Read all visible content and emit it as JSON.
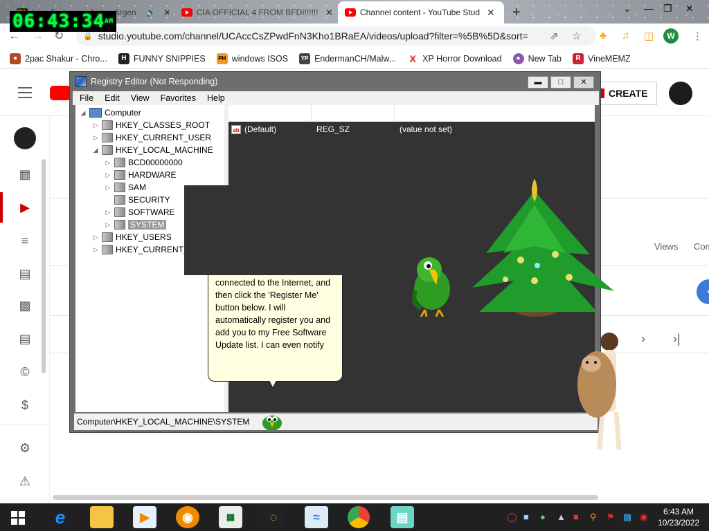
{
  "browser": {
    "tabs": [
      {
        "title": "I am Transrox - Active Argen",
        "icon": "ph-icon"
      },
      {
        "title": "CIA OFFICIAL 4 FROM BFDI!!!!!!",
        "icon": "youtube-icon"
      },
      {
        "title": "Channel content - YouTube Stud",
        "icon": "youtube-icon"
      }
    ],
    "url": "studio.youtube.com/channel/UCAccCsZPwdFnN3Kho1BRaEA/videos/upload?filter=%5B%5D&sort=%...",
    "profile_initial": "W"
  },
  "clock_overlay": {
    "time": "06:43:34",
    "suffix": "AM"
  },
  "bookmarks": [
    {
      "label": "2pac Shakur - Chro...",
      "icon": "car-icon",
      "color": "#b04b2a"
    },
    {
      "label": "FUNNY SNIPPIES",
      "icon": "h-icon",
      "color": "#222222"
    },
    {
      "label": "windows ISOS",
      "icon": "ph-icon",
      "color": "#f7971d"
    },
    {
      "label": "EndermanCH/Malw...",
      "icon": "yp-icon",
      "color": "#444444"
    },
    {
      "label": "XP Horror Download",
      "icon": "x-icon",
      "color": "#e02020"
    },
    {
      "label": "New Tab",
      "icon": "globe-icon",
      "color": "#8a5aa8"
    },
    {
      "label": "VineMEMZ",
      "icon": "r-icon",
      "color": "#cc2233"
    }
  ],
  "youtube": {
    "create_label": "CREATE",
    "columns": {
      "views": "Views",
      "comments": "Com"
    }
  },
  "regedit": {
    "title": "Registry Editor (Not Responding)",
    "menu": [
      "File",
      "Edit",
      "View",
      "Favorites",
      "Help"
    ],
    "tree": {
      "root": "Computer",
      "hives": [
        "HKEY_CLASSES_ROOT",
        "HKEY_CURRENT_USER",
        "HKEY_LOCAL_MACHINE"
      ],
      "hklm_children": [
        "BCD00000000",
        "HARDWARE",
        "SAM",
        "SECURITY",
        "SOFTWARE",
        "SYSTEM"
      ],
      "more_hives": [
        "HKEY_USERS",
        "HKEY_CURRENT_C"
      ]
    },
    "values": [
      {
        "name": "(Default)",
        "type": "REG_SZ",
        "data": "(value not set)"
      }
    ],
    "status_path": "Computer\\HKEY_LOCAL_MACHINE\\SYSTEM"
  },
  "bonzi_bubble": {
    "text": "connected to the Internet, and then click the 'Register Me' button below. I will automatically register you and add you to my Free Software Update list. I can even notify"
  },
  "taskbar": {
    "time": "6:43 AM",
    "date": "10/23/2022"
  },
  "colors": {
    "regedit_frame": "#6e6e6e",
    "youtube_red": "#ff0000",
    "taskbar": "#202020",
    "clock_green": "#00ff44"
  }
}
